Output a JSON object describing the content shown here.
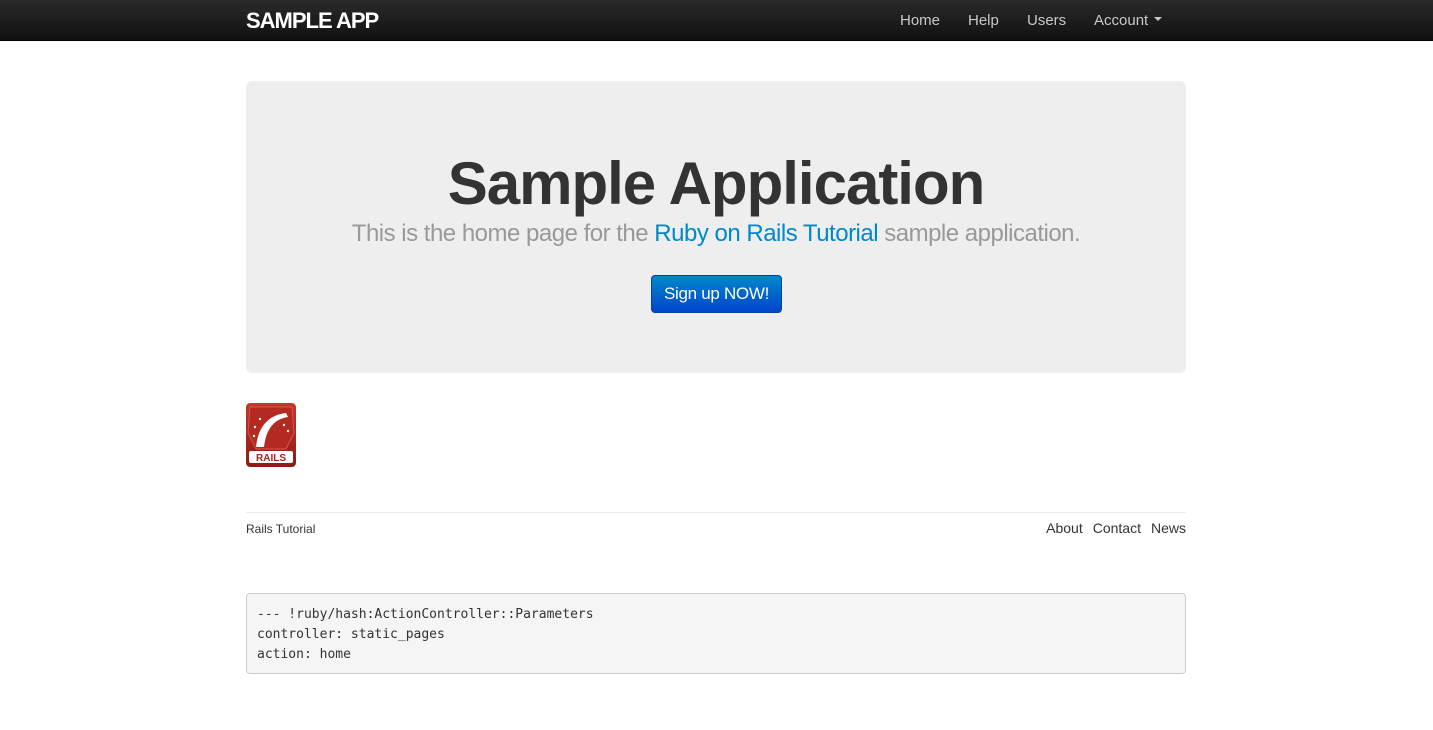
{
  "navbar": {
    "brand": "SAMPLE APP",
    "items": [
      {
        "label": "Home"
      },
      {
        "label": "Help"
      },
      {
        "label": "Users"
      },
      {
        "label": "Account"
      }
    ]
  },
  "hero": {
    "title": "Sample Application",
    "lead_prefix": "This is the home page for the ",
    "lead_link": "Ruby on Rails Tutorial",
    "lead_suffix": " sample application.",
    "signup_label": "Sign up NOW!"
  },
  "logo": {
    "text": "RAILS",
    "icon": "rails-logo-icon"
  },
  "footer": {
    "left_text": "Rails Tutorial",
    "links": [
      {
        "label": "About"
      },
      {
        "label": "Contact"
      },
      {
        "label": "News"
      }
    ]
  },
  "debug": {
    "lines": [
      "--- !ruby/hash:ActionController::Parameters",
      "controller: static_pages",
      "action: home"
    ]
  },
  "colors": {
    "navbar_bg": "#1b1b1b",
    "hero_bg": "#eeeeee",
    "link": "#0088cc",
    "button": "#0055cc",
    "logo_red": "#a8201a"
  }
}
